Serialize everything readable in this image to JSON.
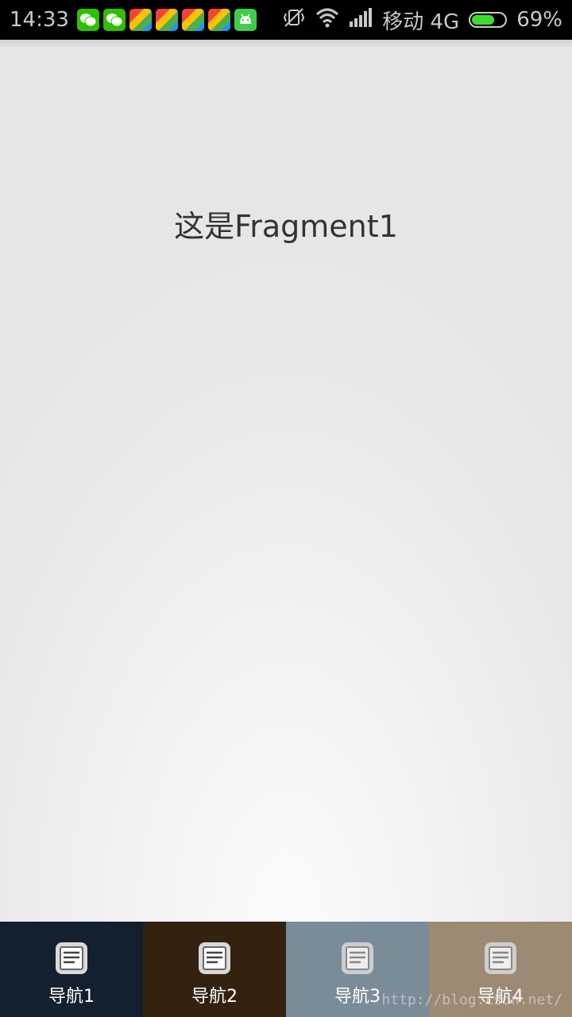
{
  "status_bar": {
    "time": "14:33",
    "carrier": "移动 4G",
    "battery_percent": "69%",
    "battery_level": 0.69,
    "notification_icons": [
      "wechat-icon",
      "wechat-icon",
      "app-icon",
      "app-icon",
      "app-icon",
      "app-icon",
      "android-icon"
    ]
  },
  "content": {
    "fragment_text": "这是Fragment1"
  },
  "bottom_nav": {
    "items": [
      {
        "label": "导航1",
        "color": "#13202e",
        "icon": "document-icon"
      },
      {
        "label": "导航2",
        "color": "#33220f",
        "icon": "document-icon"
      },
      {
        "label": "导航3",
        "color": "#7b8c99",
        "icon": "document-icon"
      },
      {
        "label": "导航4",
        "color": "#9c8a75",
        "icon": "document-icon"
      }
    ]
  },
  "watermark": "http://blog.csdn.net/"
}
